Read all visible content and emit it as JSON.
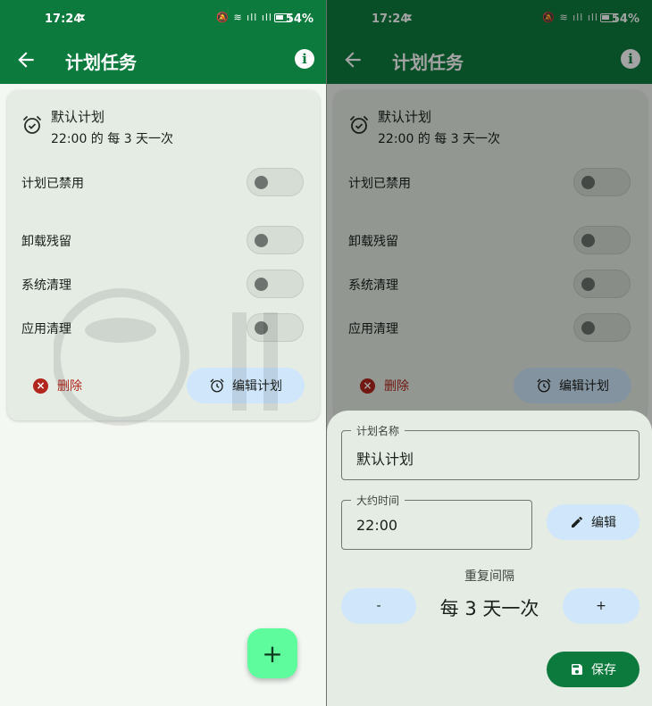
{
  "status_bar": {
    "time": "17:24",
    "battery_pct": "54%"
  },
  "app_bar": {
    "title": "计划任务",
    "back_icon": "arrow-back-icon",
    "info_icon": "info-icon"
  },
  "plan_card": {
    "name": "默认计划",
    "schedule": "22:00 的 每 3 天一次",
    "rows": [
      {
        "label": "计划已禁用",
        "on": false
      },
      {
        "label": "卸载残留",
        "on": false
      },
      {
        "label": "系统清理",
        "on": false
      },
      {
        "label": "应用清理",
        "on": false
      }
    ],
    "delete_label": "删除",
    "edit_label": "编辑计划"
  },
  "fab": {
    "label": "+"
  },
  "sheet": {
    "name_field": {
      "legend": "计划名称",
      "value": "默认计划"
    },
    "time_field": {
      "legend": "大约时间",
      "value": "22:00"
    },
    "edit_label": "编辑",
    "repeat_label": "重复间隔",
    "minus_label": "-",
    "repeat_value": "每 3 天一次",
    "plus_label": "+",
    "save_label": "保存"
  },
  "colors": {
    "primary": "#0d7a3d",
    "fab": "#5efc9d",
    "tonal_button": "#cfe6fb",
    "danger": "#b3261e"
  }
}
